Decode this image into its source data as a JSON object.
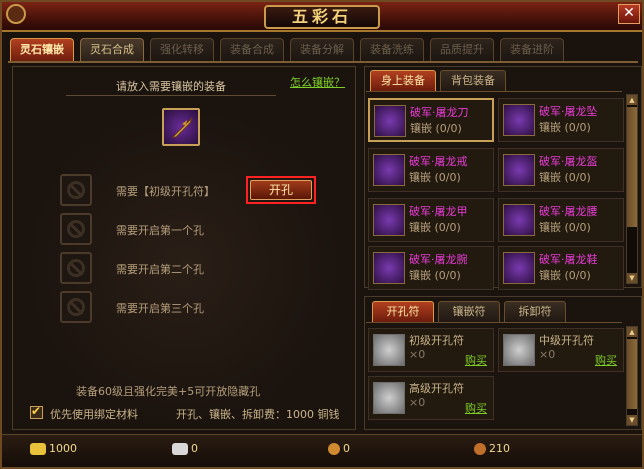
{
  "window": {
    "title": "五彩石",
    "close_icon": "close-icon"
  },
  "top_tabs": [
    {
      "label": "灵石镶嵌",
      "state": "active"
    },
    {
      "label": "灵石合成",
      "state": "semi"
    },
    {
      "label": "强化转移",
      "state": "disabled"
    },
    {
      "label": "装备合成",
      "state": "disabled"
    },
    {
      "label": "装备分解",
      "state": "disabled"
    },
    {
      "label": "装备洗练",
      "state": "disabled"
    },
    {
      "label": "品质提升",
      "state": "disabled"
    },
    {
      "label": "装备进阶",
      "state": "disabled"
    }
  ],
  "left": {
    "instruction": "请放入需要镶嵌的装备",
    "how_link": "怎么镶嵌？",
    "holes": [
      {
        "text": "需要【初级开孔符】"
      },
      {
        "text": "需要开启第一个孔"
      },
      {
        "text": "需要开启第二个孔"
      },
      {
        "text": "需要开启第三个孔"
      }
    ],
    "open_button": "开孔",
    "hint": "装备60级且强化完美+5可开放隐藏孔",
    "checkbox_label": "优先使用绑定材料",
    "checkbox_checked": true,
    "fee_text": "开孔、镶嵌、拆卸费：1000 铜钱"
  },
  "equip_tabs": [
    {
      "label": "身上装备",
      "state": "active"
    },
    {
      "label": "背包装备",
      "state": "inactive"
    }
  ],
  "equip_items": [
    {
      "name": "破军·屠龙刀",
      "sub": "镶嵌  (0/0)",
      "selected": true
    },
    {
      "name": "破军·屠龙坠",
      "sub": "镶嵌  (0/0)",
      "selected": false
    },
    {
      "name": "破军·屠龙戒",
      "sub": "镶嵌  (0/0)",
      "selected": false
    },
    {
      "name": "破军·屠龙盔",
      "sub": "镶嵌  (0/0)",
      "selected": false
    },
    {
      "name": "破军·屠龙甲",
      "sub": "镶嵌  (0/0)",
      "selected": false
    },
    {
      "name": "破军·屠龙腰",
      "sub": "镶嵌  (0/0)",
      "selected": false
    },
    {
      "name": "破军·屠龙腕",
      "sub": "镶嵌  (0/0)",
      "selected": false
    },
    {
      "name": "破军·屠龙鞋",
      "sub": "镶嵌  (0/0)",
      "selected": false
    }
  ],
  "tool_tabs": [
    {
      "label": "开孔符",
      "state": "active"
    },
    {
      "label": "镶嵌符",
      "state": "inactive"
    },
    {
      "label": "拆卸符",
      "state": "inactive"
    }
  ],
  "tools": [
    {
      "name": "初级开孔符",
      "count": "×0",
      "buy": "购买"
    },
    {
      "name": "中级开孔符",
      "count": "×0",
      "buy": "购买"
    },
    {
      "name": "高级开孔符",
      "count": "×0",
      "buy": "购买"
    }
  ],
  "currency": [
    {
      "icon": "gold-ingot-icon",
      "value": "1000",
      "color": "#e8c23a"
    },
    {
      "icon": "bound-ingot-icon",
      "value": "0",
      "color": "#d8d8d8"
    },
    {
      "icon": "copper-coin-icon",
      "value": "0",
      "color": "#d08a30"
    },
    {
      "icon": "bound-copper-icon",
      "value": "210",
      "color": "#c0702a"
    }
  ],
  "colors": {
    "accent": "#b1401f",
    "item_name": "#e83cd6",
    "link": "#7dcf28",
    "highlight_border": "#ff2222"
  }
}
